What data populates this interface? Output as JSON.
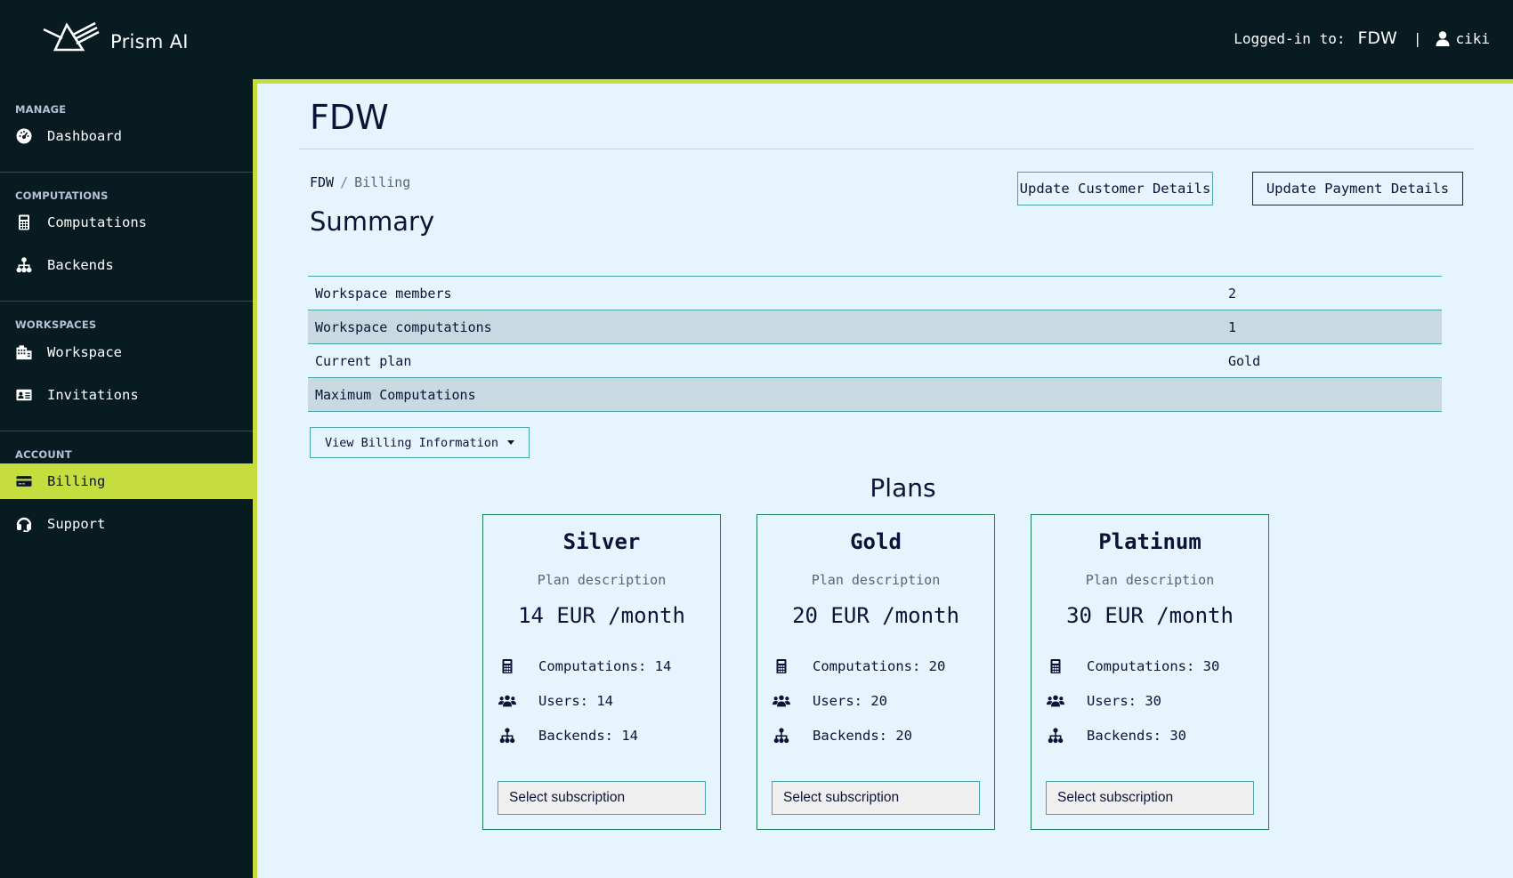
{
  "app": {
    "name": "Prism AI",
    "logo_icon": "prism-logo-icon"
  },
  "header": {
    "logged_in_label": "Logged-in to:",
    "workspace": "FDW",
    "separator": "|",
    "user_icon": "user-icon",
    "username": "ciki"
  },
  "sidebar": {
    "sections": [
      {
        "label": "MANAGE",
        "items": [
          {
            "label": "Dashboard",
            "icon": "dashboard-gauge-icon"
          }
        ]
      },
      {
        "label": "COMPUTATIONS",
        "items": [
          {
            "label": "Computations",
            "icon": "calculator-icon"
          },
          {
            "label": "Backends",
            "icon": "sitemap-icon"
          }
        ]
      },
      {
        "label": "WORKSPACES",
        "items": [
          {
            "label": "Workspace",
            "icon": "building-icon"
          },
          {
            "label": "Invitations",
            "icon": "id-card-icon"
          }
        ]
      },
      {
        "label": "ACCOUNT",
        "items": [
          {
            "label": "Billing",
            "icon": "credit-card-icon",
            "active": true
          },
          {
            "label": "Support",
            "icon": "headset-icon"
          }
        ]
      }
    ]
  },
  "main": {
    "title": "FDW",
    "breadcrumb": {
      "parent": "FDW",
      "separator": "/",
      "current": "Billing"
    },
    "summary_title": "Summary",
    "buttons": {
      "update_customer": "Update Customer Details",
      "update_payment": "Update Payment Details",
      "view_billing": "View Billing Information"
    },
    "summary_rows": [
      {
        "label": "Workspace members",
        "value": "2"
      },
      {
        "label": "Workspace computations",
        "value": "1"
      },
      {
        "label": "Current plan",
        "value": "Gold"
      },
      {
        "label": "Maximum Computations",
        "value": ""
      }
    ],
    "plans_title": "Plans",
    "plans": [
      {
        "name": "Silver",
        "description": "Plan description",
        "price": "14 EUR /month",
        "computations": "Computations: 14",
        "users": "Users: 14",
        "backends": "Backends: 14",
        "select_label": "Select subscription"
      },
      {
        "name": "Gold",
        "description": "Plan description",
        "price": "20 EUR /month",
        "computations": "Computations: 20",
        "users": "Users: 20",
        "backends": "Backends: 20",
        "select_label": "Select subscription"
      },
      {
        "name": "Platinum",
        "description": "Plan description",
        "price": "30 EUR /month",
        "computations": "Computations: 30",
        "users": "Users: 30",
        "backends": "Backends: 30",
        "select_label": "Select subscription"
      }
    ]
  },
  "colors": {
    "sidebar_bg": "#081b21",
    "accent": "#c6dd40",
    "main_bg": "#e6f4fd",
    "table_alt_row": "#c9d9e1",
    "teal_border": "#4aa3a8",
    "card_border": "#1f7f5c",
    "text_dark": "#0b1437"
  }
}
